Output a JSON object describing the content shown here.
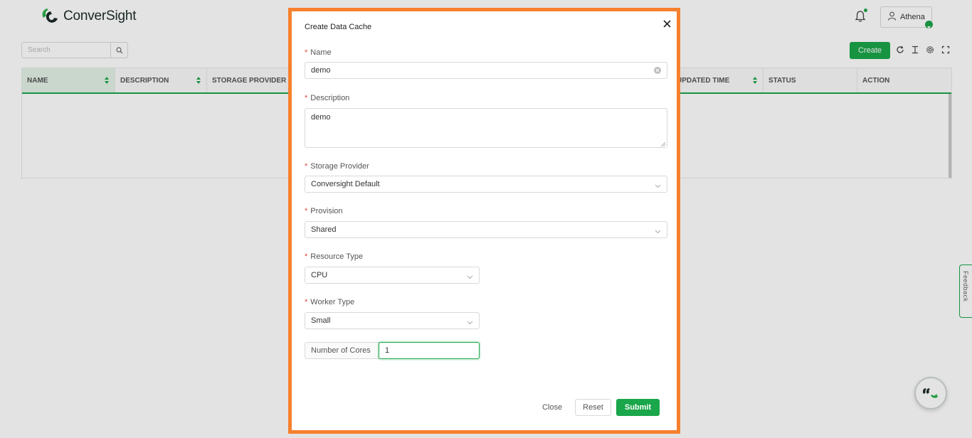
{
  "app": {
    "brand": "ConverSight",
    "user_name": "Athena",
    "search_placeholder": "Search",
    "create_label": "Create",
    "feedback_label": "Feedback",
    "accent_color": "#1aa64a"
  },
  "table": {
    "columns": [
      "NAME",
      "DESCRIPTION",
      "STORAGE PROVIDER",
      "UPDATED TIME",
      "STATUS",
      "ACTION"
    ]
  },
  "modal": {
    "title": "Create Data Cache",
    "fields": {
      "name": {
        "label": "Name",
        "value": "demo"
      },
      "description": {
        "label": "Description",
        "value": "demo"
      },
      "storage_provider": {
        "label": "Storage Provider",
        "value": "Conversight Default"
      },
      "provision": {
        "label": "Provision",
        "value": "Shared"
      },
      "resource_type": {
        "label": "Resource Type",
        "value": "CPU"
      },
      "worker_type": {
        "label": "Worker Type",
        "value": "Small"
      },
      "cores": {
        "label": "Number of Cores",
        "value": "1"
      }
    },
    "required_marker": "*",
    "buttons": {
      "close": "Close",
      "reset": "Reset",
      "submit": "Submit"
    },
    "frame_color": "#f6802d"
  }
}
